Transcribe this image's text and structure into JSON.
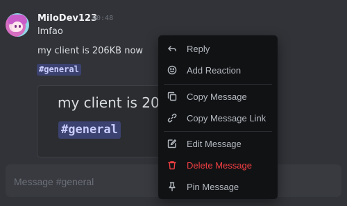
{
  "message": {
    "username": "MiloDev123",
    "timestamp": "00:48",
    "lines": [
      "lmfao",
      "my client is 206KB now"
    ],
    "mention": "#general"
  },
  "embed": {
    "text": "my client is 206KB now",
    "mention": "#general"
  },
  "composer": {
    "placeholder": "Message #general"
  },
  "context_menu": {
    "items": [
      {
        "label": "Reply",
        "icon": "reply-icon"
      },
      {
        "label": "Add Reaction",
        "icon": "smiley-icon"
      },
      {
        "label": "Copy Message",
        "icon": "copy-icon"
      },
      {
        "label": "Copy Message Link",
        "icon": "link-icon"
      },
      {
        "label": "Edit Message",
        "icon": "pencil-icon"
      },
      {
        "label": "Delete Message",
        "icon": "trash-icon"
      },
      {
        "label": "Pin Message",
        "icon": "pin-icon"
      }
    ]
  },
  "colors": {
    "background": "#313338",
    "menu_background": "#111214",
    "danger": "#f23f43",
    "mention_background": "#3c4270",
    "mention_text": "#c9cdfb"
  }
}
